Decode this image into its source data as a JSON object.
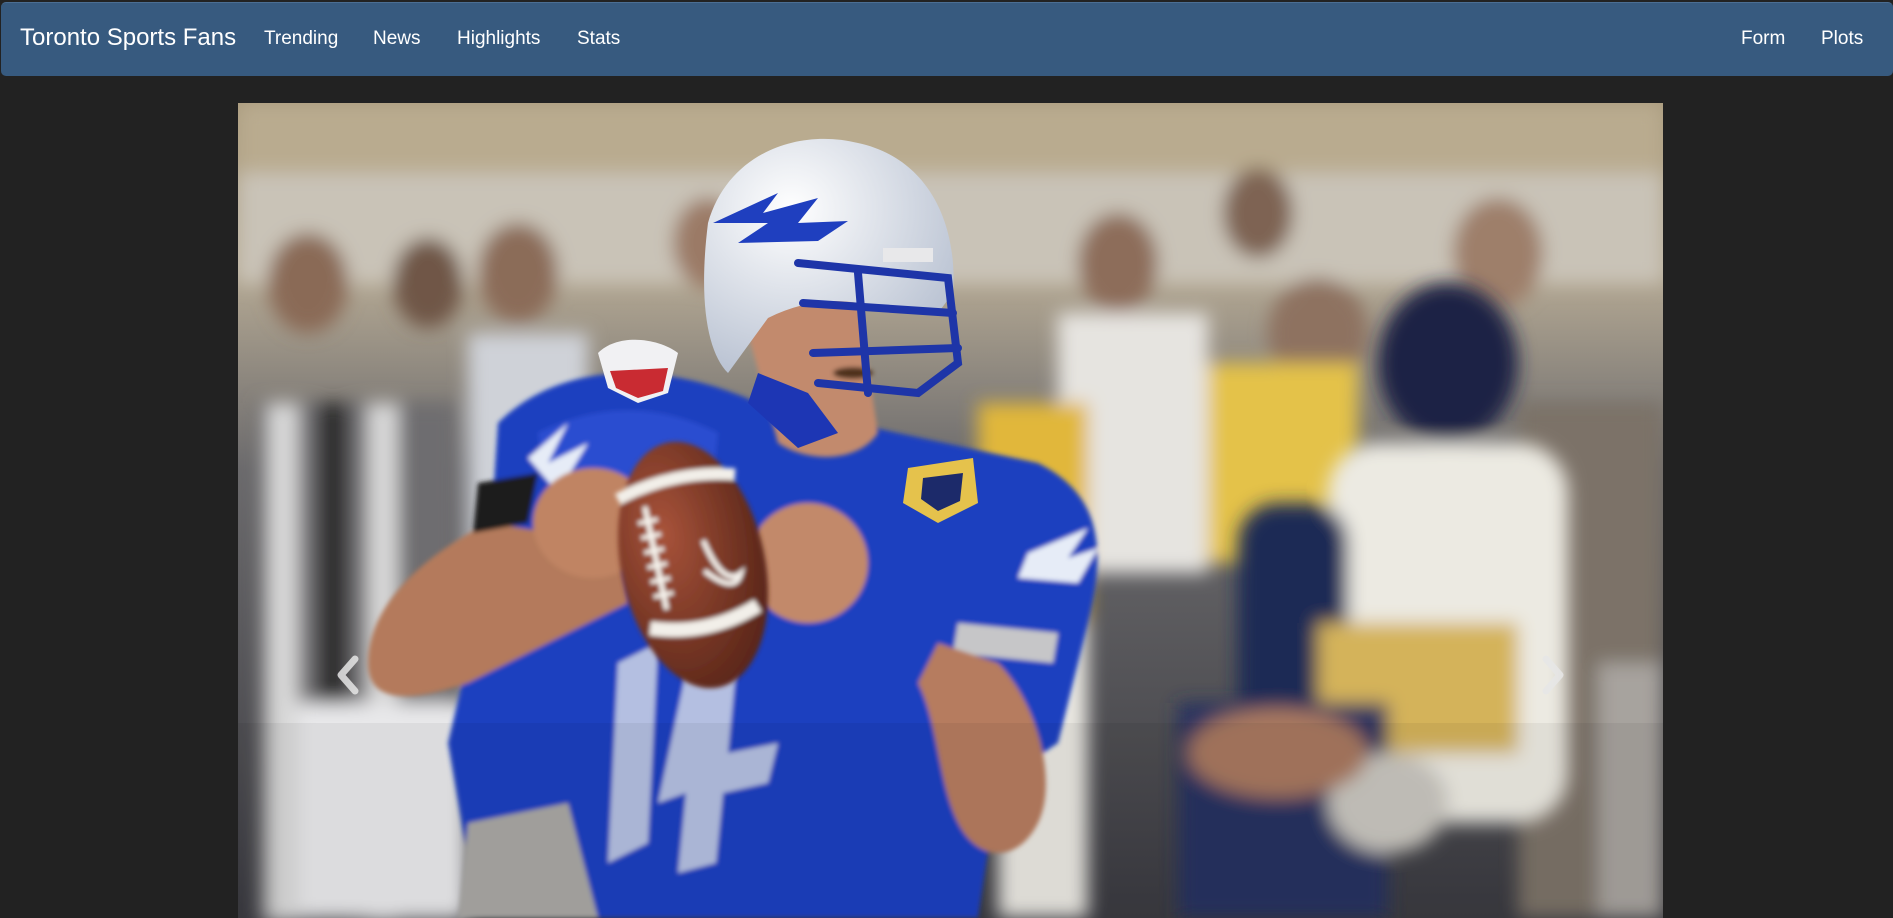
{
  "navbar": {
    "brand": "Toronto Sports Fans",
    "left_links": [
      {
        "label": "Trending"
      },
      {
        "label": "News"
      },
      {
        "label": "Highlights"
      },
      {
        "label": "Stats"
      }
    ],
    "right_links": [
      {
        "label": "Form"
      },
      {
        "label": "Plots"
      }
    ],
    "background": "#375a7f"
  },
  "page": {
    "background": "#222222"
  },
  "carousel": {
    "slide_image": "football-quarterback-photo",
    "prev_icon": "chevron-left-icon",
    "next_icon": "chevron-right-icon"
  }
}
